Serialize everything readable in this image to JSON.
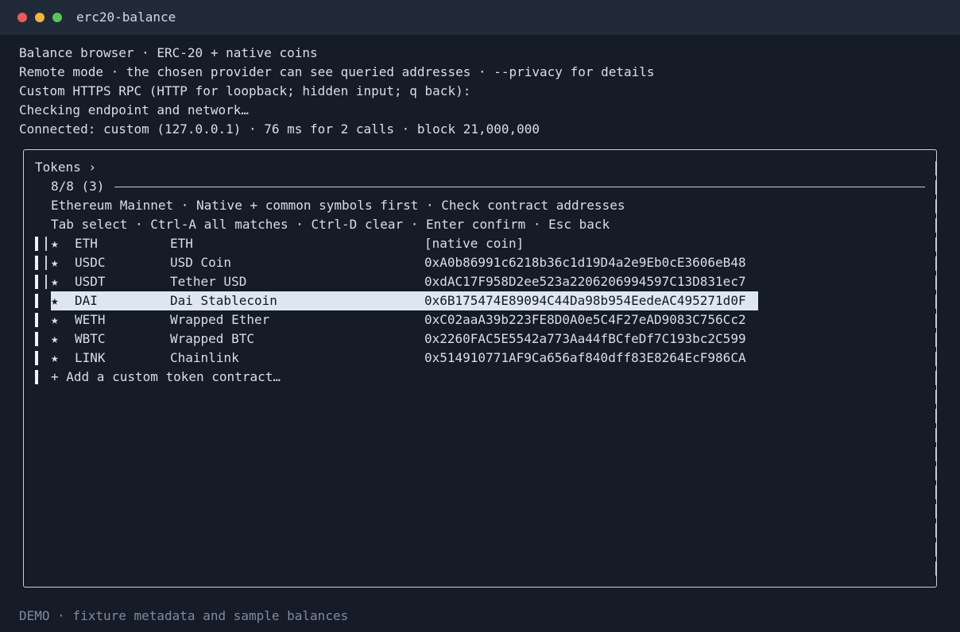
{
  "window": {
    "title": "erc20-balance"
  },
  "header_lines": [
    "Balance browser · ERC-20 + native coins",
    "Remote mode · the chosen provider can see queried addresses · --privacy for details",
    "Custom HTTPS RPC (HTTP for loopback; hidden input; q back):",
    "Checking endpoint and network…",
    "Connected: custom (127.0.0.1) · 76 ms for 2 calls · block 21,000,000"
  ],
  "panel": {
    "title": "Tokens ›",
    "count": "8/8 (3)",
    "network_info": "Ethereum Mainnet · Native + common symbols first · Check contract addresses",
    "keys_help": "Tab select · Ctrl-A all matches · Ctrl-D clear · Enter confirm · Esc back"
  },
  "tokens": [
    {
      "star": "★",
      "symbol": "ETH",
      "name": "ETH",
      "address": "[native coin]",
      "selected": true,
      "highlighted": false
    },
    {
      "star": "★",
      "symbol": "USDC",
      "name": "USD Coin",
      "address": "0xA0b86991c6218b36c1d19D4a2e9Eb0cE3606eB48",
      "selected": true,
      "highlighted": false
    },
    {
      "star": "★",
      "symbol": "USDT",
      "name": "Tether USD",
      "address": "0xdAC17F958D2ee523a2206206994597C13D831ec7",
      "selected": true,
      "highlighted": false
    },
    {
      "star": "★",
      "symbol": "DAI",
      "name": "Dai Stablecoin",
      "address": "0x6B175474E89094C44Da98b954EedeAC495271d0F",
      "selected": false,
      "highlighted": true
    },
    {
      "star": "★",
      "symbol": "WETH",
      "name": "Wrapped Ether",
      "address": "0xC02aaA39b223FE8D0A0e5C4F27eAD9083C756Cc2",
      "selected": false,
      "highlighted": false
    },
    {
      "star": "★",
      "symbol": "WBTC",
      "name": "Wrapped BTC",
      "address": "0x2260FAC5E5542a773Aa44fBCfeDf7C193bc2C599",
      "selected": false,
      "highlighted": false
    },
    {
      "star": "★",
      "symbol": "LINK",
      "name": "Chainlink",
      "address": "0x514910771AF9Ca656af840dff83E8264EcF986CA",
      "selected": false,
      "highlighted": false
    }
  ],
  "add_custom_label": "+ Add a custom token contract…",
  "footer": {
    "demo_note": "DEMO · fixture metadata and sample balances"
  },
  "colors": {
    "background": "#151b27",
    "titlebar": "#212a39",
    "highlight": "#dde6f2",
    "muted": "#7f8aa1"
  }
}
